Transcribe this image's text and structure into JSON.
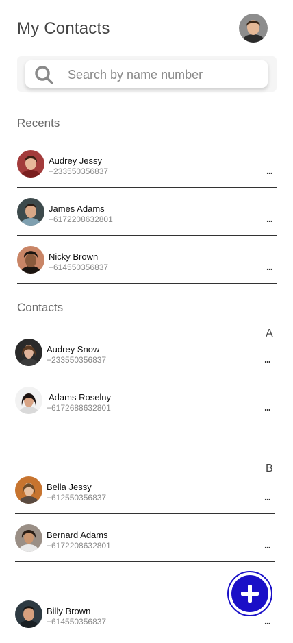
{
  "header": {
    "title": "My Contacts",
    "profile_avatar": "user-profile-avatar"
  },
  "search": {
    "placeholder": "Search by name number",
    "icon": "search-icon"
  },
  "recents": {
    "heading": "Recents",
    "items": [
      {
        "name": "Audrey Jessy",
        "phone": "+233550356837",
        "more": "...",
        "avatar_bg": "#a33b3b",
        "skin": "#e8b79a",
        "hair": "#3a1f14"
      },
      {
        "name": "James Adams",
        "phone": "+6172208632801",
        "more": "...",
        "avatar_bg": "#3d4a4c",
        "skin": "#d9a887",
        "hair": "#2a1c14"
      },
      {
        "name": "Nicky Brown",
        "phone": "+614550356837",
        "more": "...",
        "avatar_bg": "#c98566",
        "skin": "#8a5a3c",
        "hair": "#1a1410"
      }
    ]
  },
  "contacts": {
    "heading": "Contacts",
    "groups": [
      {
        "letter": "A",
        "items": [
          {
            "name": "Audrey Snow",
            "phone": "+233550356837",
            "more": "...",
            "avatar_bg": "#2a2a2a",
            "skin": "#e0b39a",
            "hair": "#5a3a22"
          },
          {
            "name": "Adams Roselny",
            "phone": "+6172688632801",
            "more": "...",
            "avatar_bg": "#f2f2f2",
            "skin": "#d8a485",
            "hair": "#1c1412"
          }
        ]
      },
      {
        "letter": "B",
        "items": [
          {
            "name": "Bella Jessy",
            "phone": "+612550356837",
            "more": "...",
            "avatar_bg": "#c7742f",
            "skin": "#e8c0a0",
            "hair": "#6a4a2a"
          },
          {
            "name": "Bernard Adams",
            "phone": "+6172208632801",
            "more": "...",
            "avatar_bg": "#9a8f86",
            "skin": "#c9956f",
            "hair": "#2a1e16"
          },
          {
            "name": "Billy Brown",
            "phone": "+614550356837",
            "more": "...",
            "avatar_bg": "#2e3a42",
            "skin": "#d6a07e",
            "hair": "#1a1614"
          }
        ]
      }
    ]
  },
  "fab": {
    "icon": "plus-icon",
    "color": "#1a0fc7"
  },
  "colors": {
    "accent": "#1a0fc7",
    "divider": "#333333",
    "secondary_text": "#8a8a8a"
  }
}
